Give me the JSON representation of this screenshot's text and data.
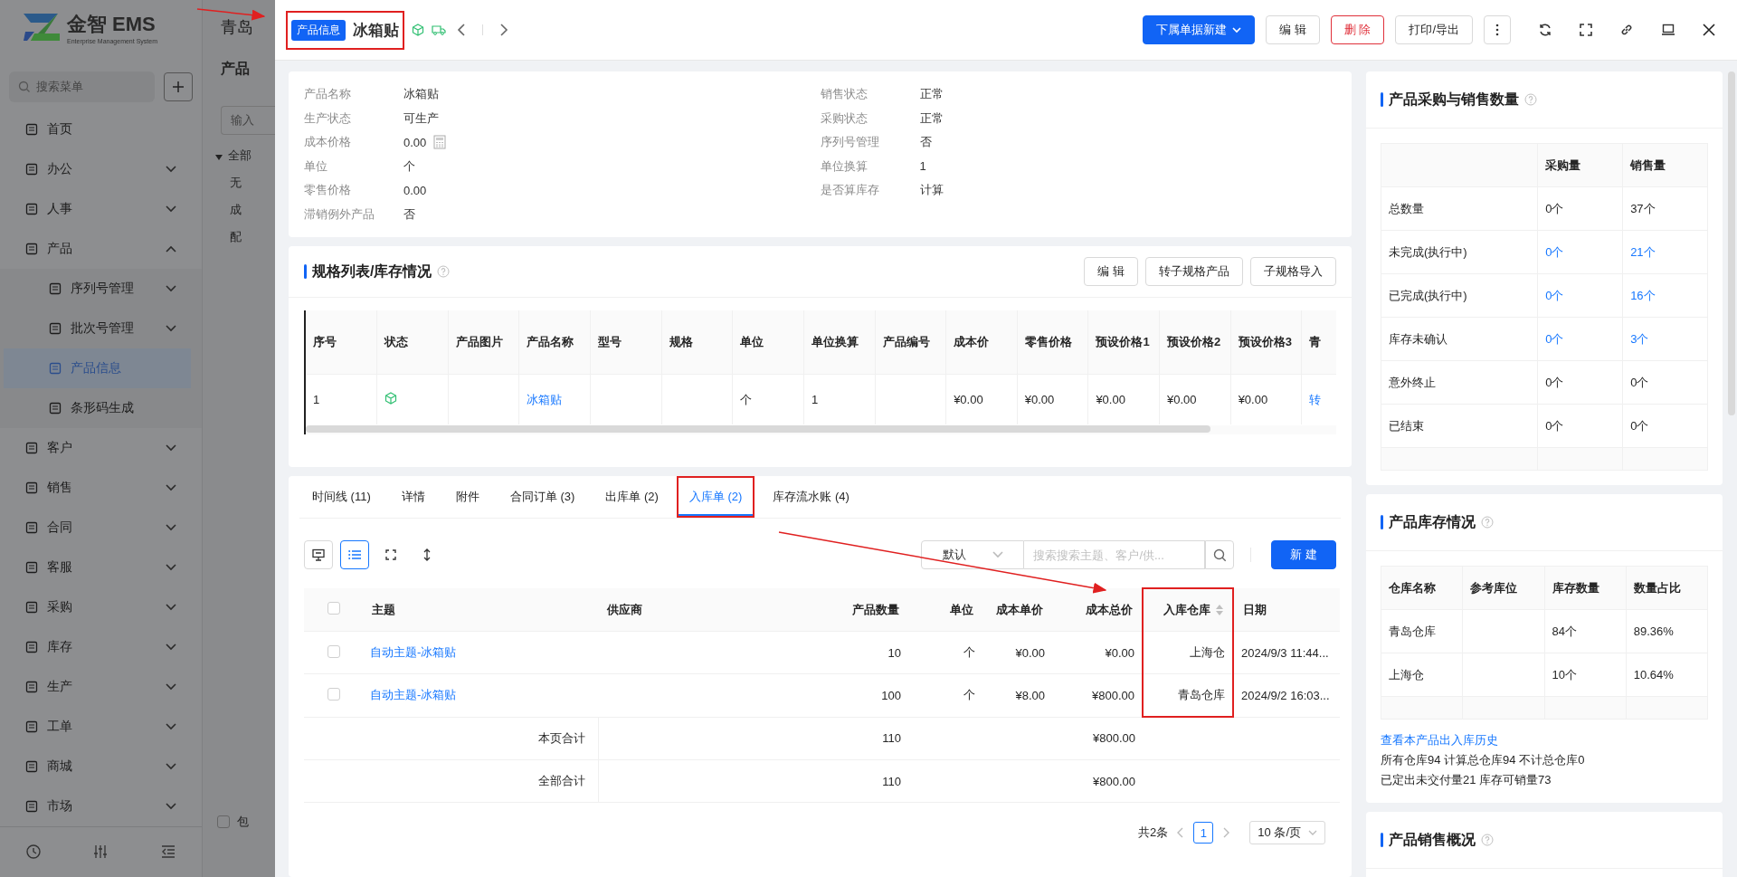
{
  "background": {
    "company": "青岛",
    "page_title": "产品",
    "search_placeholder": "输入",
    "tree": [
      {
        "label": "全部",
        "expanded": true,
        "children": [
          {
            "label": "无"
          },
          {
            "label": "成"
          },
          {
            "label": "配"
          }
        ]
      }
    ],
    "checkbox": {
      "label": "包",
      "checked": false
    }
  },
  "sidebar": {
    "logo_title": "金智 EMS",
    "logo_subtitle": "Enterprise Management System",
    "search_placeholder": "搜索菜单",
    "items": [
      {
        "label": "首页",
        "kind": "link",
        "selected": false
      },
      {
        "label": "办公",
        "kind": "group",
        "expanded": false
      },
      {
        "label": "人事",
        "kind": "group",
        "expanded": false
      },
      {
        "label": "产品",
        "kind": "group",
        "expanded": true,
        "children": [
          {
            "label": "序列号管理",
            "kind": "group",
            "expanded": false
          },
          {
            "label": "批次号管理",
            "kind": "group",
            "expanded": false
          },
          {
            "label": "产品信息",
            "kind": "link",
            "selected": true
          },
          {
            "label": "条形码生成",
            "kind": "link",
            "selected": false
          }
        ]
      },
      {
        "label": "客户",
        "kind": "group",
        "expanded": false
      },
      {
        "label": "销售",
        "kind": "group",
        "expanded": false
      },
      {
        "label": "合同",
        "kind": "group",
        "expanded": false
      },
      {
        "label": "客服",
        "kind": "group",
        "expanded": false
      },
      {
        "label": "采购",
        "kind": "group",
        "expanded": false
      },
      {
        "label": "库存",
        "kind": "group",
        "expanded": false
      },
      {
        "label": "生产",
        "kind": "group",
        "expanded": false
      },
      {
        "label": "工单",
        "kind": "group",
        "expanded": false
      },
      {
        "label": "商城",
        "kind": "group",
        "expanded": false
      },
      {
        "label": "市场",
        "kind": "group",
        "expanded": false
      }
    ]
  },
  "drawer": {
    "tag": "产品信息",
    "title": "冰箱贴",
    "annotated": true,
    "buttons": [
      {
        "label": "下属单据新建",
        "kind": "primary",
        "caret": true
      },
      {
        "label": "编 辑",
        "kind": "default",
        "caret": false
      },
      {
        "label": "删 除",
        "kind": "danger",
        "caret": false
      },
      {
        "label": "打印/导出",
        "kind": "default",
        "caret": false
      }
    ]
  },
  "info": {
    "left": [
      {
        "label": "产品名称",
        "value": "冰箱贴"
      },
      {
        "label": "生产状态",
        "value": "可生产"
      },
      {
        "label": "成本价格",
        "value": "0.00",
        "calculator": true
      },
      {
        "label": "单位",
        "value": "个"
      },
      {
        "label": "零售价格",
        "value": "0.00"
      },
      {
        "label": "滞销例外产品",
        "value": "否"
      }
    ],
    "right": [
      {
        "label": "销售状态",
        "value": "正常"
      },
      {
        "label": "采购状态",
        "value": "正常"
      },
      {
        "label": "序列号管理",
        "value": "否"
      },
      {
        "label": "单位换算",
        "value": "1"
      },
      {
        "label": "是否算库存",
        "value": "计算"
      }
    ]
  },
  "spec": {
    "title": "规格列表/库存情况",
    "buttons": [
      "编 辑",
      "转子规格产品",
      "子规格导入"
    ],
    "columns": [
      "序号",
      "状态",
      "产品图片",
      "产品名称",
      "型号",
      "规格",
      "单位",
      "单位换算",
      "产品编号",
      "成本价",
      "零售价格",
      "预设价格1",
      "预设价格2",
      "预设价格3",
      "青"
    ],
    "rows": [
      {
        "cells": [
          {
            "kind": "text",
            "text": "1"
          },
          {
            "kind": "status"
          },
          {
            "kind": "empty"
          },
          {
            "kind": "link",
            "text": "冰箱贴"
          },
          {
            "kind": "empty"
          },
          {
            "kind": "empty"
          },
          {
            "kind": "text",
            "text": "个"
          },
          {
            "kind": "text",
            "text": "1"
          },
          {
            "kind": "empty"
          },
          {
            "kind": "text",
            "text": "¥0.00"
          },
          {
            "kind": "text",
            "text": "¥0.00"
          },
          {
            "kind": "text",
            "text": "¥0.00"
          },
          {
            "kind": "text",
            "text": "¥0.00"
          },
          {
            "kind": "text",
            "text": "¥0.00"
          },
          {
            "kind": "link",
            "text": "转"
          }
        ]
      }
    ]
  },
  "tabs": [
    {
      "label": "时间线 (11)",
      "selected": false,
      "annotated": false
    },
    {
      "label": "详情",
      "selected": false,
      "annotated": false
    },
    {
      "label": "附件",
      "selected": false,
      "annotated": false
    },
    {
      "label": "合同订单 (3)",
      "selected": false,
      "annotated": false
    },
    {
      "label": "出库单 (2)",
      "selected": false,
      "annotated": false
    },
    {
      "label": "入库单 (2)",
      "selected": true,
      "annotated": true
    },
    {
      "label": "库存流水账 (4)",
      "selected": false,
      "annotated": false
    }
  ],
  "inbound": {
    "view_buttons": [
      {
        "selected": false
      },
      {
        "selected": true
      },
      {
        "selected": false
      },
      {
        "selected": false
      }
    ],
    "all_checked": false,
    "filter_value": "默认",
    "search_placeholder": "搜索搜索主题、客户/供...",
    "new_button": "新 建",
    "columns": [
      {
        "label": "主题",
        "sortable": false,
        "annotated": false
      },
      {
        "label": "供应商",
        "sortable": false,
        "annotated": false
      },
      {
        "label": "产品数量",
        "sortable": false,
        "annotated": false
      },
      {
        "label": "单位",
        "sortable": false,
        "annotated": false
      },
      {
        "label": "成本单价",
        "sortable": false,
        "annotated": false
      },
      {
        "label": "成本总价",
        "sortable": false,
        "annotated": false
      },
      {
        "label": "入库仓库",
        "sortable": true,
        "annotated": true
      },
      {
        "label": "日期",
        "sortable": false,
        "annotated": false
      }
    ],
    "rows": [
      {
        "checked": false,
        "cells": [
          {
            "text": "自动主题-冰箱贴",
            "kind": "link"
          },
          {
            "kind": "empty"
          },
          {
            "text": "10",
            "kind": "text"
          },
          {
            "text": "个",
            "kind": "text"
          },
          {
            "text": "¥0.00",
            "kind": "text"
          },
          {
            "text": "¥0.00",
            "kind": "text"
          },
          {
            "text": "上海仓",
            "kind": "text"
          },
          {
            "text": "2024/9/3 11:44...",
            "kind": "text"
          }
        ]
      },
      {
        "checked": false,
        "cells": [
          {
            "text": "自动主题-冰箱贴",
            "kind": "link"
          },
          {
            "kind": "empty"
          },
          {
            "text": "100",
            "kind": "text"
          },
          {
            "text": "个",
            "kind": "text"
          },
          {
            "text": "¥8.00",
            "kind": "text"
          },
          {
            "text": "¥800.00",
            "kind": "text"
          },
          {
            "text": "青岛仓库",
            "kind": "text"
          },
          {
            "text": "2024/9/2 16:03...",
            "kind": "text"
          }
        ]
      }
    ],
    "totals": [
      {
        "label": "本页合计",
        "quantity": "110",
        "total": "¥800.00"
      },
      {
        "label": "全部合计",
        "quantity": "110",
        "total": "¥800.00"
      }
    ],
    "pagination": {
      "total": "共2条",
      "pages": [
        {
          "label": "1",
          "selected": true
        }
      ],
      "page_size": "10 条/页"
    }
  },
  "purchase_sales": {
    "title": "产品采购与销售数量",
    "columns": [
      "采购量",
      "销售量"
    ],
    "rows": [
      {
        "label": "总数量",
        "values": [
          {
            "text": "0个",
            "link": false
          },
          {
            "text": "37个",
            "link": false
          }
        ]
      },
      {
        "label": "未完成(执行中)",
        "values": [
          {
            "text": "0个",
            "link": true
          },
          {
            "text": "21个",
            "link": true
          }
        ]
      },
      {
        "label": "已完成(执行中)",
        "values": [
          {
            "text": "0个",
            "link": true
          },
          {
            "text": "16个",
            "link": true
          }
        ]
      },
      {
        "label": "库存未确认",
        "values": [
          {
            "text": "0个",
            "link": true
          },
          {
            "text": "3个",
            "link": true
          }
        ]
      },
      {
        "label": "意外终止",
        "values": [
          {
            "text": "0个",
            "link": false
          },
          {
            "text": "0个",
            "link": false
          }
        ]
      },
      {
        "label": "已结束",
        "values": [
          {
            "text": "0个",
            "link": false
          },
          {
            "text": "0个",
            "link": false
          }
        ]
      }
    ]
  },
  "stock": {
    "title": "产品库存情况",
    "columns": [
      "仓库名称",
      "参考库位",
      "库存数量",
      "数量占比"
    ],
    "rows": [
      {
        "warehouse": "青岛仓库",
        "quantity": "84个",
        "share": "89.36%"
      },
      {
        "warehouse": "上海仓",
        "quantity": "10个",
        "share": "10.64%"
      }
    ],
    "history_link": "查看本产品出入库历史",
    "notes": [
      "所有仓库94 计算总仓库94 不计总仓库0",
      "已定出未交付量21 库存可销量73"
    ]
  },
  "sales": {
    "title": "产品销售概况"
  }
}
